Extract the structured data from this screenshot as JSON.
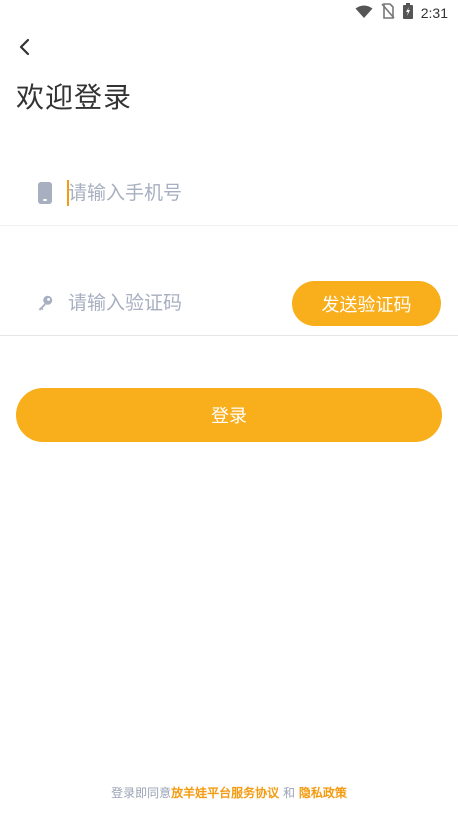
{
  "status_bar": {
    "time": "2:31",
    "icons": [
      "wifi-icon",
      "no-sim-icon",
      "battery-charging-icon"
    ]
  },
  "header": {
    "back_icon": "chevron-left-icon",
    "title": "欢迎登录"
  },
  "form": {
    "phone": {
      "icon": "phone-icon",
      "placeholder": "请输入手机号",
      "value": ""
    },
    "code": {
      "icon": "key-icon",
      "placeholder": "请输入验证码",
      "value": "",
      "send_button_label": "发送验证码"
    },
    "login_label": "登录"
  },
  "agreement": {
    "prefix": "登录即同意",
    "service_link": "放羊娃平台服务协议",
    "conjunction": " 和 ",
    "privacy_link": "隐私政策"
  },
  "colors": {
    "accent": "#f9ae1b",
    "link": "#f39c12",
    "placeholder": "#a7afc0"
  }
}
